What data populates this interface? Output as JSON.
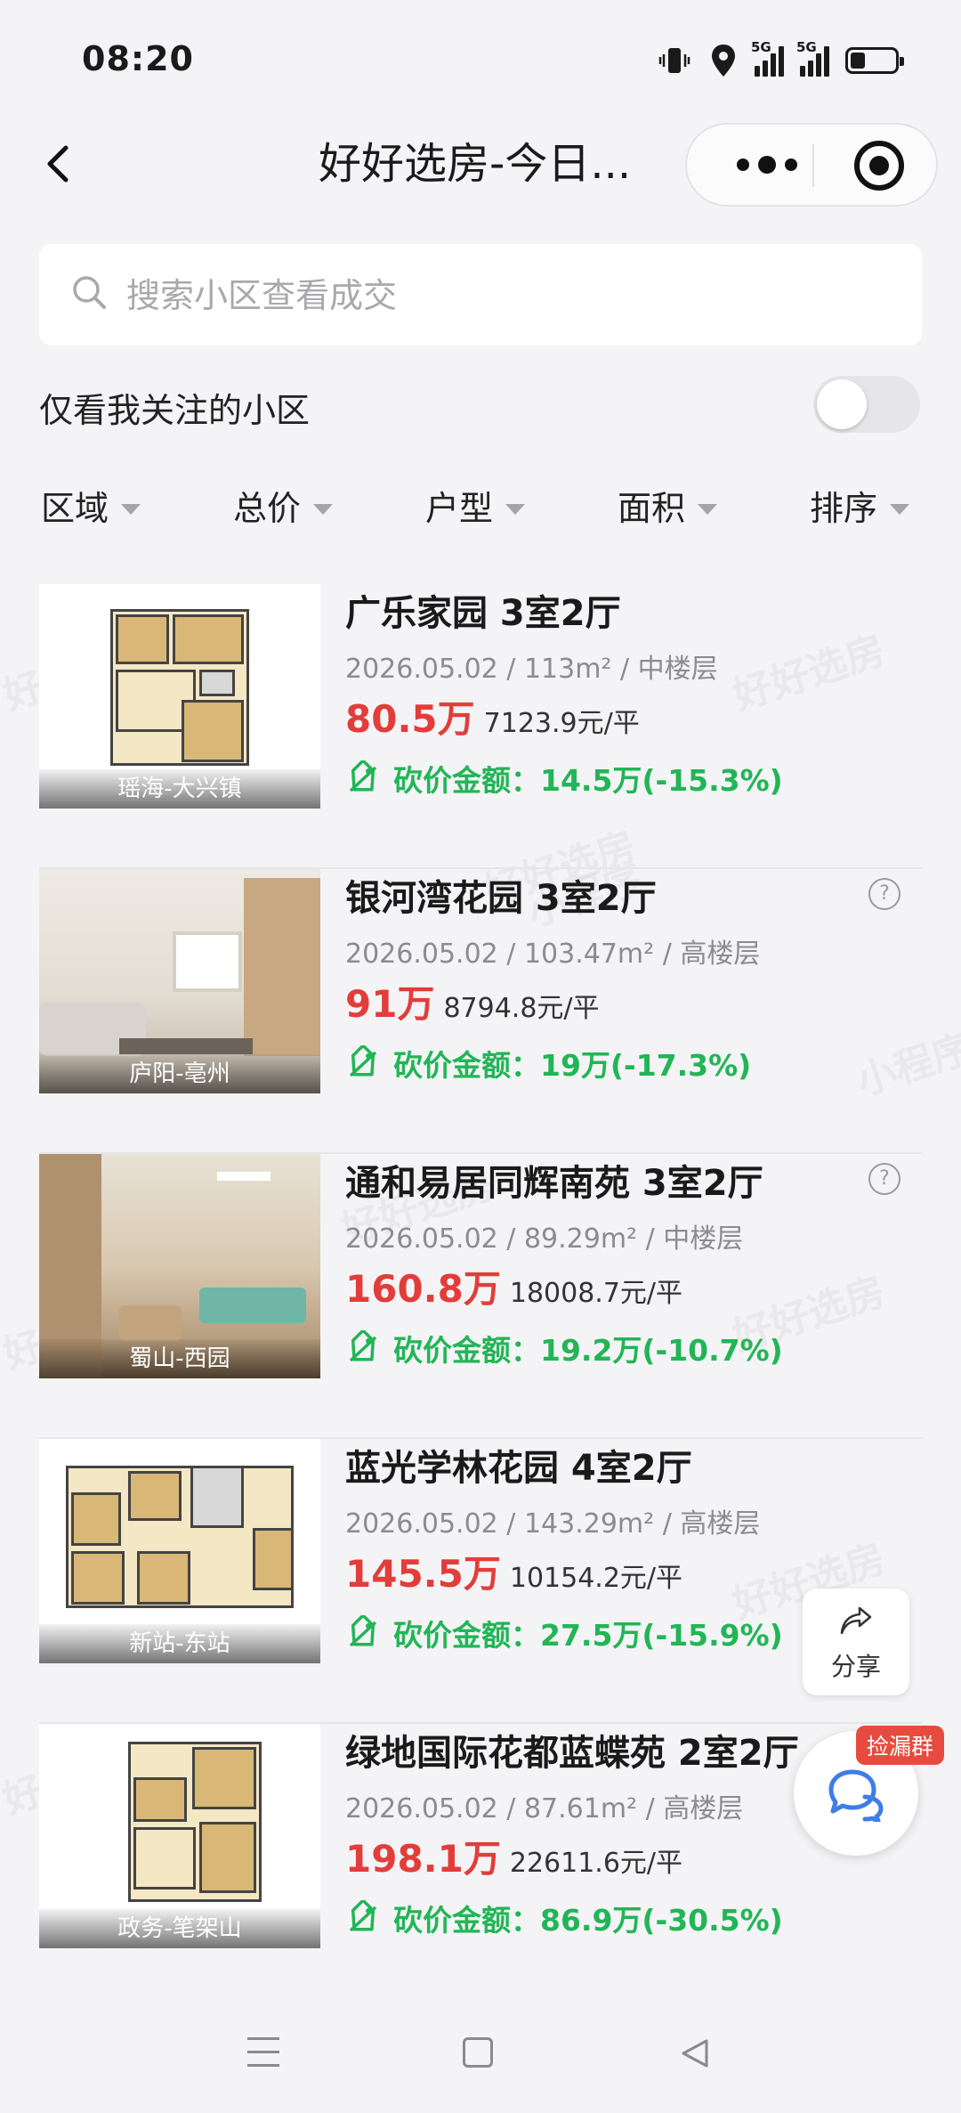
{
  "status_bar": {
    "time": "08:20",
    "net1": "5G",
    "net2": "5G"
  },
  "nav": {
    "title": "好好选房-今日..."
  },
  "search": {
    "placeholder": "搜索小区查看成交"
  },
  "follow_filter": {
    "label": "仅看我关注的小区",
    "enabled": false
  },
  "filters": [
    "区域",
    "总价",
    "户型",
    "面积",
    "排序"
  ],
  "listings": [
    {
      "title": "广乐家园 3室2厅",
      "meta": "2026.05.02 / 113m² / 中楼层",
      "price": "80.5万",
      "unit_price": "7123.9元/平",
      "cut": "砍价金额：14.5万(-15.3%)",
      "location": "瑶海-大兴镇",
      "has_help": false
    },
    {
      "title": "银河湾花园 3室2厅",
      "meta": "2026.05.02 / 103.47m² / 高楼层",
      "price": "91万",
      "unit_price": "8794.8元/平",
      "cut": "砍价金额：19万(-17.3%)",
      "location": "庐阳-亳州",
      "has_help": true
    },
    {
      "title": "通和易居同辉南苑 3室2厅",
      "meta": "2026.05.02 / 89.29m² / 中楼层",
      "price": "160.8万",
      "unit_price": "18008.7元/平",
      "cut": "砍价金额：19.2万(-10.7%)",
      "location": "蜀山-西园",
      "has_help": true
    },
    {
      "title": "蓝光学林花园 4室2厅",
      "meta": "2026.05.02 / 143.29m² / 高楼层",
      "price": "145.5万",
      "unit_price": "10154.2元/平",
      "cut": "砍价金额：27.5万(-15.9%)",
      "location": "新站-东站",
      "has_help": false
    },
    {
      "title": "绿地国际花都蓝蝶苑 2室2厅",
      "meta": "2026.05.02 / 87.61m² / 高楼层",
      "price": "198.1万",
      "unit_price": "22611.6元/平",
      "cut": "砍价金额：86.9万(-30.5%)",
      "location": "政务-笔架山",
      "has_help": false
    }
  ],
  "floating": {
    "share_label": "分享",
    "group_badge": "捡漏群"
  },
  "watermarks": [
    "好好选房",
    "小程序"
  ]
}
